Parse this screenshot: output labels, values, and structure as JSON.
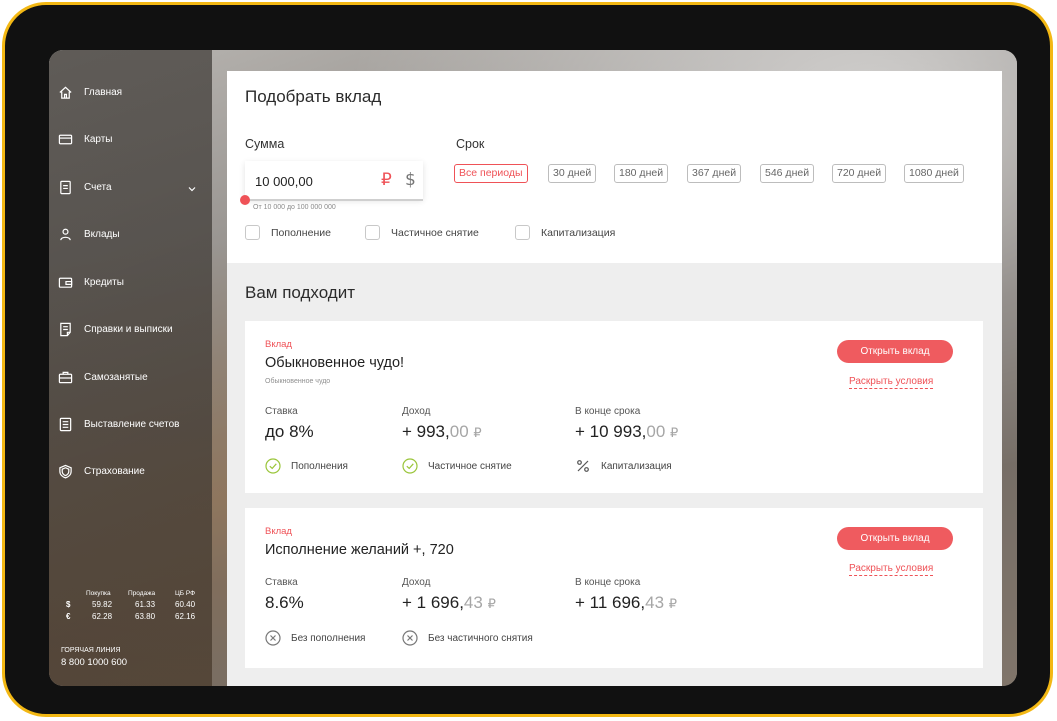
{
  "sidebar": {
    "items": [
      {
        "label": "Главная",
        "icon": "home-icon"
      },
      {
        "label": "Карты",
        "icon": "card-icon"
      },
      {
        "label": "Счета",
        "icon": "document-icon"
      },
      {
        "label": "Вклады",
        "icon": "person-icon"
      },
      {
        "label": "Кредиты",
        "icon": "wallet-icon"
      },
      {
        "label": "Справки и выписки",
        "icon": "statement-icon"
      },
      {
        "label": "Самозанятые",
        "icon": "briefcase-icon"
      },
      {
        "label": "Выставление счетов",
        "icon": "invoice-icon"
      },
      {
        "label": "Страхование",
        "icon": "shield-icon"
      }
    ],
    "rates": {
      "headers": [
        "Покупка",
        "Продажа",
        "ЦБ РФ"
      ],
      "rows": [
        {
          "symbol": "$",
          "buy": "59.82",
          "sell": "61.33",
          "cb": "60.40"
        },
        {
          "symbol": "€",
          "buy": "62.28",
          "sell": "63.80",
          "cb": "62.16"
        }
      ]
    },
    "hotline": {
      "label": "ГОРЯЧАЯ ЛИНИЯ",
      "number": "8 800 1000 600"
    }
  },
  "filter": {
    "title": "Подобрать вклад",
    "amount_label": "Сумма",
    "amount_value": "10 000,00",
    "currency_rub": "₽",
    "currency_usd": "$",
    "range_hint": "От 10 000 до 100 000 000",
    "term_label": "Срок",
    "periods": [
      "Все периоды",
      "30 дней",
      "180 дней",
      "367 дней",
      "546 дней",
      "720 дней",
      "1080 дней"
    ],
    "options": [
      "Пополнение",
      "Частичное снятие",
      "Капитализация"
    ]
  },
  "results": {
    "title": "Вам подходит",
    "cards": [
      {
        "kind": "Вклад",
        "name": "Обыкновенное чудо!",
        "subtitle": "Обыкновенное чудо",
        "rate_label": "Ставка",
        "rate": "до 8%",
        "income_label": "Доход",
        "income_int": "+ 993,",
        "income_dec": "00",
        "end_label": "В конце срока",
        "end_int": "+ 10 993,",
        "end_dec": "00",
        "ruble": "₽",
        "features": [
          "Пополнения",
          "Частичное снятие",
          "Капитализация"
        ],
        "open_button": "Открыть вклад",
        "terms_link": "Раскрыть условия"
      },
      {
        "kind": "Вклад",
        "name": "Исполнение желаний +, 720",
        "rate_label": "Ставка",
        "rate": "8.6%",
        "income_label": "Доход",
        "income_int": "+ 1 696,",
        "income_dec": "43",
        "end_label": "В конце срока",
        "end_int": "+ 11 696,",
        "end_dec": "43",
        "ruble": "₽",
        "features": [
          "Без пополнения",
          "Без частичного снятия"
        ],
        "open_button": "Открыть вклад",
        "terms_link": "Раскрыть условия"
      }
    ]
  },
  "colors": {
    "accent": "#ef5257",
    "frame": "#f3b814"
  }
}
